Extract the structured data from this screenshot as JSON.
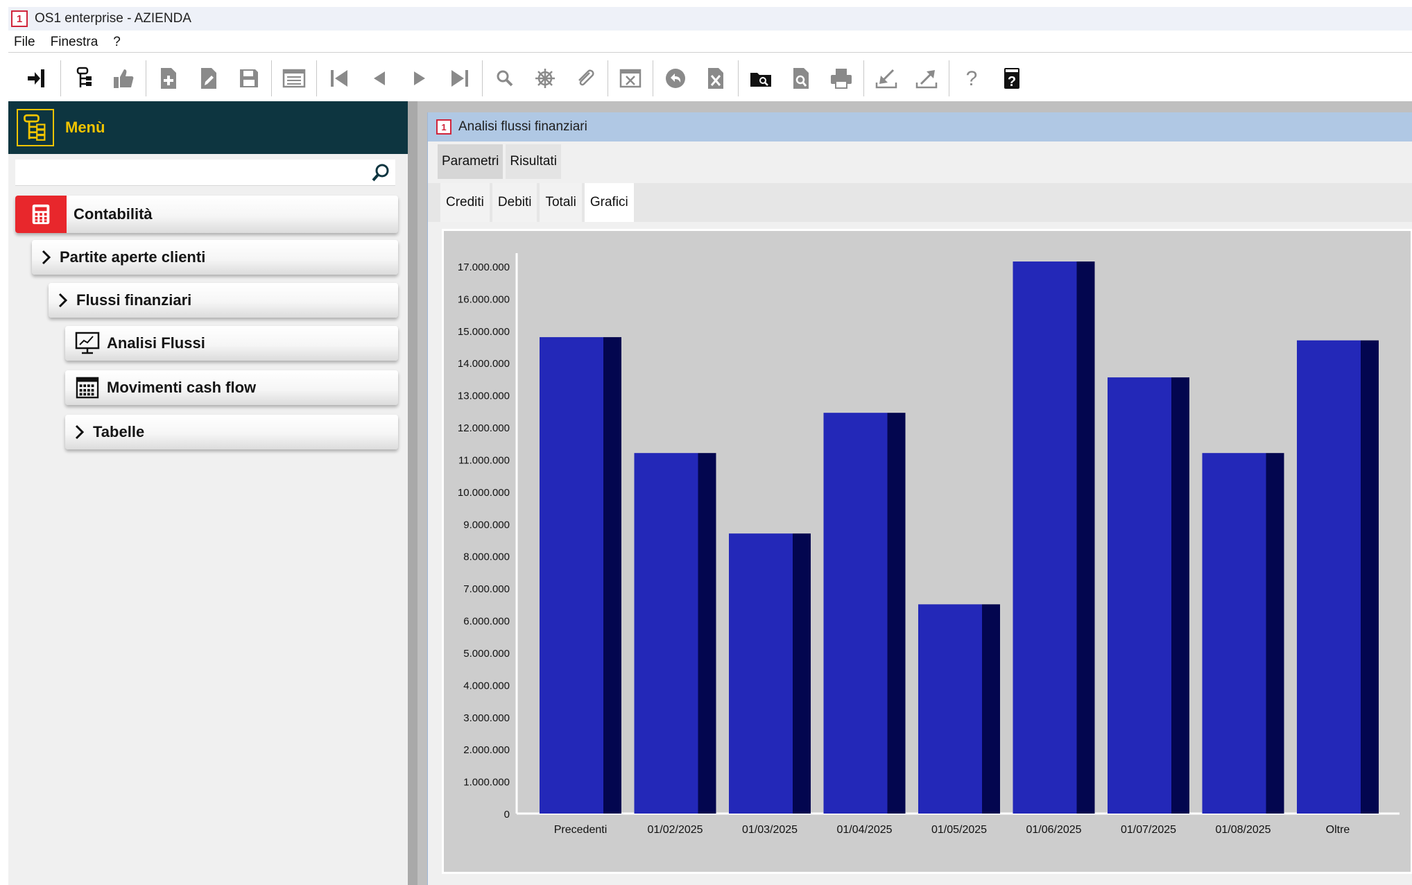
{
  "app": {
    "title": "OS1 enterprise - AZIENDA",
    "logo_text": "1"
  },
  "menubar": [
    "File",
    "Finestra",
    "?"
  ],
  "toolbar": {
    "icons": [
      "exit-icon",
      "tree-icon",
      "thumbs-up-icon",
      "new-document-icon",
      "edit-document-icon",
      "save-icon",
      "list-icon",
      "first-record-icon",
      "previous-record-icon",
      "next-record-icon",
      "last-record-icon",
      "search-icon",
      "settings-wheel-icon",
      "attachment-icon",
      "cancel-window-icon",
      "undo-icon",
      "delete-document-icon",
      "open-folder-search-icon",
      "preview-icon",
      "print-icon",
      "import-icon",
      "export-icon",
      "help-icon",
      "manual-icon"
    ]
  },
  "sidebar": {
    "header_label": "Menù",
    "search": {
      "value": "",
      "placeholder": ""
    },
    "items": [
      {
        "label": "Contabilità",
        "icon": "calculator-icon"
      },
      {
        "label": "Partite aperte clienti",
        "icon": "chevron-right-icon"
      },
      {
        "label": "Flussi finanziari",
        "icon": "chevron-right-icon"
      },
      {
        "label": "Analisi Flussi",
        "icon": "monitor-chart-icon"
      },
      {
        "label": "Movimenti cash flow",
        "icon": "calendar-grid-icon"
      },
      {
        "label": "Tabelle",
        "icon": "chevron-right-icon"
      }
    ]
  },
  "window": {
    "title": "Analisi flussi finanziari",
    "logo_text": "1",
    "tabs": [
      "Parametri",
      "Risultati"
    ],
    "active_tab": "Parametri",
    "subtabs": [
      "Crediti",
      "Debiti",
      "Totali",
      "Grafici"
    ],
    "active_subtab": "Grafici"
  },
  "chart_data": {
    "type": "bar",
    "title": "",
    "xlabel": "",
    "ylabel": "",
    "categories": [
      "Precedenti",
      "01/02/2025",
      "01/03/2025",
      "01/04/2025",
      "01/05/2025",
      "01/06/2025",
      "01/07/2025",
      "01/08/2025",
      "Oltre"
    ],
    "values": [
      14800000,
      11200000,
      8700000,
      12450000,
      6500000,
      17150000,
      13550000,
      11200000,
      14700000
    ],
    "ylim": [
      0,
      17000000
    ],
    "yticks": [
      "0",
      "1.000.000",
      "2.000.000",
      "3.000.000",
      "4.000.000",
      "5.000.000",
      "6.000.000",
      "7.000.000",
      "8.000.000",
      "9.000.000",
      "10.000.000",
      "11.000.000",
      "12.000.000",
      "13.000.000",
      "14.000.000",
      "15.000.000",
      "16.000.000",
      "17.000.000"
    ],
    "grid": false,
    "legend": "none",
    "colors": {
      "bar_front": "#2328b8",
      "bar_side": "#03064f",
      "background": "#cdcdcd"
    }
  }
}
